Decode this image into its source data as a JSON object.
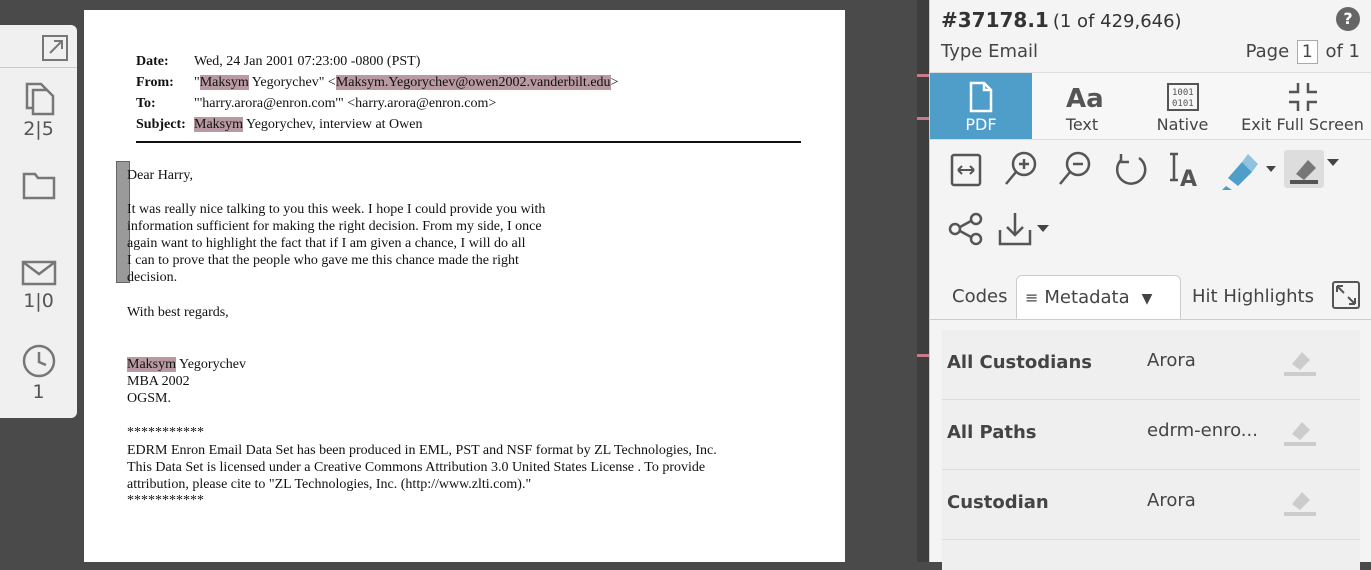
{
  "rail": {
    "productions_count": "2|5",
    "mail_count": "1|0",
    "history_count": "1"
  },
  "document": {
    "header": {
      "date_label": "Date:",
      "date_value": "Wed, 24 Jan 2001 07:23:00 -0800 (PST)",
      "from_label": "From:",
      "from_prefix": "\"",
      "from_name_hl": "Maksym",
      "from_name_rest": " Yegorychev\" <",
      "from_email_hl": "Maksym.Yegorychev@owen2002.vanderbilt.edu",
      "from_suffix": ">",
      "to_label": "To:",
      "to_value": "\"'harry.arora@enron.com'\" <harry.arora@enron.com>",
      "subject_label": "Subject:",
      "subject_hl": "Maksym",
      "subject_rest": " Yegorychev, interview at Owen"
    },
    "greeting": "Dear Harry,",
    "body_lines": [
      "It was really nice talking to you this week. I hope I could provide you with",
      "information sufficient for making the right decision. From my side, I once",
      "again want to highlight the fact that if I am given a chance, I will do all",
      "I can to prove that the people who gave me this chance made the right",
      "decision."
    ],
    "closing": "With best regards,",
    "sig_name_hl": "Maksym",
    "sig_name_rest": " Yegorychev",
    "sig_line2": "MBA 2002",
    "sig_line3": "OGSM.",
    "stars_top": "***********",
    "footer_lines": [
      "EDRM Enron Email Data Set has been produced in EML, PST and NSF format by ZL Technologies, Inc.",
      "This Data Set is licensed under a Creative Commons Attribution 3.0 United States License . To provide",
      "attribution, please cite to \"ZL Technologies, Inc. (http://www.zlti.com).\""
    ],
    "stars_bottom": "***********"
  },
  "panel": {
    "doc_id": "#37178.1",
    "doc_count": "(1 of 429,646)",
    "help": "?",
    "doc_type": "Type Email",
    "page_label": "Page",
    "page_value": "1",
    "page_total": "of 1",
    "view_tabs": {
      "pdf": "PDF",
      "text": "Text",
      "native": "Native",
      "exit": "Exit Full Screen"
    },
    "native_icon_text_1": "1001",
    "native_icon_text_2": "0101",
    "tabs": {
      "codes": "Codes",
      "metadata": "Metadata",
      "hits": "Hit Highlights"
    },
    "metadata": [
      {
        "key": "All Custodians",
        "value": "Arora"
      },
      {
        "key": "All Paths",
        "value": "edrm-enro..."
      },
      {
        "key": "Custodian",
        "value": "Arora"
      }
    ]
  },
  "colors": {
    "accent": "#4f9ec9",
    "highlight": "#b99aa2"
  }
}
